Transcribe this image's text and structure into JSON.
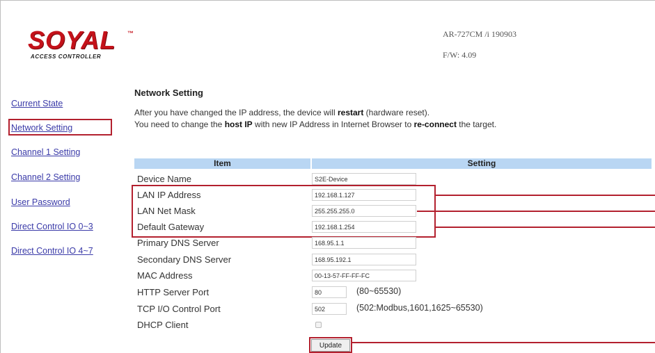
{
  "brand": {
    "logo_text": "SOYAL",
    "logo_tm": "™",
    "logo_subtitle": "ACCESS CONTROLLER",
    "red": "#c4121a"
  },
  "device_info": {
    "model": "AR-727CM /i 190903",
    "firmware": "F/W: 4.09"
  },
  "sidebar": {
    "items": [
      {
        "label": "Current State"
      },
      {
        "label": "Network Setting"
      },
      {
        "label": "Channel 1 Setting"
      },
      {
        "label": "Channel 2 Setting"
      },
      {
        "label": "User Password"
      },
      {
        "label": "Direct Control IO 0~3"
      },
      {
        "label": "Direct Control IO 4~7"
      }
    ]
  },
  "content": {
    "title": "Network Setting",
    "note_line1": {
      "pre": "After you have changed the IP address, the device will ",
      "b1": "restart",
      "post": " (hardware reset)."
    },
    "note_line2": {
      "pre": "You need to change the ",
      "b1": "host IP",
      "mid": " with new IP Address in Internet Browser to ",
      "b2": "re-connect",
      "post": " the target."
    },
    "table": {
      "header_item": "Item",
      "header_setting": "Setting"
    },
    "fields": {
      "device_name": {
        "label": "Device Name",
        "value": "S2E-Device"
      },
      "lan_ip": {
        "label": "LAN IP Address",
        "value": "192.168.1.127"
      },
      "lan_mask": {
        "label": "LAN Net Mask",
        "value": "255.255.255.0"
      },
      "gateway": {
        "label": "Default Gateway",
        "value": "192.168.1.254"
      },
      "dns1": {
        "label": "Primary DNS Server",
        "value": "168.95.1.1"
      },
      "dns2": {
        "label": "Secondary DNS Server",
        "value": "168.95.192.1"
      },
      "mac": {
        "label": "MAC Address",
        "value": "00-13-57-FF-FF-FC"
      },
      "http_port": {
        "label": "HTTP Server Port",
        "value": "80",
        "range": "(80~65530)"
      },
      "tcp_port": {
        "label": "TCP I/O Control Port",
        "value": "502",
        "range": "(502:Modbus,1601,1625~65530)"
      },
      "dhcp": {
        "label": "DHCP Client",
        "checked": false
      }
    },
    "update_label": "Update"
  },
  "highlight_color": "#b3202e",
  "header_bg": "#b9d6f3",
  "link_color": "#3a3aa8"
}
